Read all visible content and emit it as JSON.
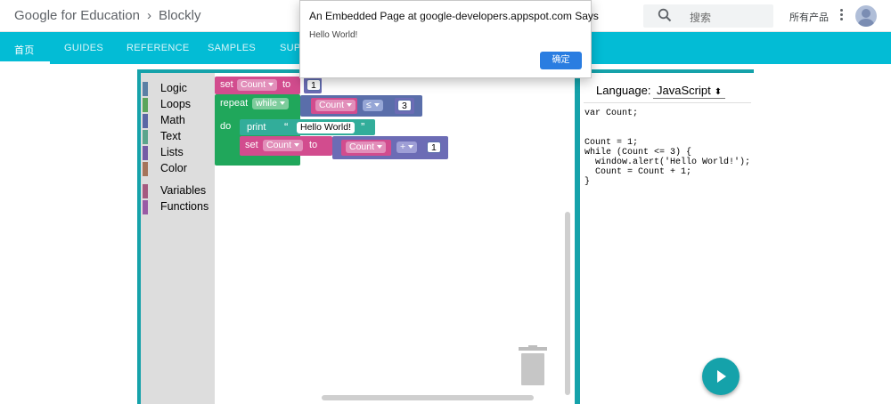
{
  "header": {
    "brand_primary": "Google for Education",
    "brand_secondary": "Blockly",
    "search_placeholder": "搜索",
    "all_products": "所有产品"
  },
  "nav": {
    "tabs": [
      {
        "label": "首页",
        "active": true
      },
      {
        "label": "GUIDES",
        "active": false
      },
      {
        "label": "REFERENCE",
        "active": false
      },
      {
        "label": "SAMPLES",
        "active": false
      },
      {
        "label": "SUP",
        "active": false
      }
    ]
  },
  "dialog": {
    "title": "An Embedded Page at google-developers.appspot.com Says",
    "message": "Hello World!",
    "ok_label": "确定"
  },
  "toolbox": {
    "categories": [
      {
        "label": "Logic",
        "color": "#5b80a5"
      },
      {
        "label": "Loops",
        "color": "#5ba55b"
      },
      {
        "label": "Math",
        "color": "#5b67a5"
      },
      {
        "label": "Text",
        "color": "#5ba58c"
      },
      {
        "label": "Lists",
        "color": "#745ba5"
      },
      {
        "label": "Color",
        "color": "#a5745b"
      },
      {
        "label": "Variables",
        "color": "#a55b80"
      },
      {
        "label": "Functions",
        "color": "#995ba5"
      }
    ]
  },
  "blocks": {
    "set1_kw": "set",
    "set1_var": "Count",
    "set1_to": "to",
    "set1_value": "1",
    "repeat_kw": "repeat",
    "repeat_mode": "while",
    "cmp_var": "Count",
    "cmp_op": "≤",
    "cmp_value": "3",
    "do_kw": "do",
    "print_kw": "print",
    "print_quote_open": "“",
    "print_text": "Hello World!",
    "print_quote_close": "”",
    "set2_kw": "set",
    "set2_var": "Count",
    "set2_to": "to",
    "add_var": "Count",
    "add_op": "+",
    "add_value": "1"
  },
  "codepanel": {
    "language_label": "Language:",
    "language_value": "JavaScript",
    "code": "var Count;\n\n\nCount = 1;\nwhile (Count <= 3) {\n  window.alert('Hello World!');\n  Count = Count + 1;\n}"
  },
  "colors": {
    "brand_cyan": "#03bcd5",
    "frame_teal": "#15a2aa"
  }
}
